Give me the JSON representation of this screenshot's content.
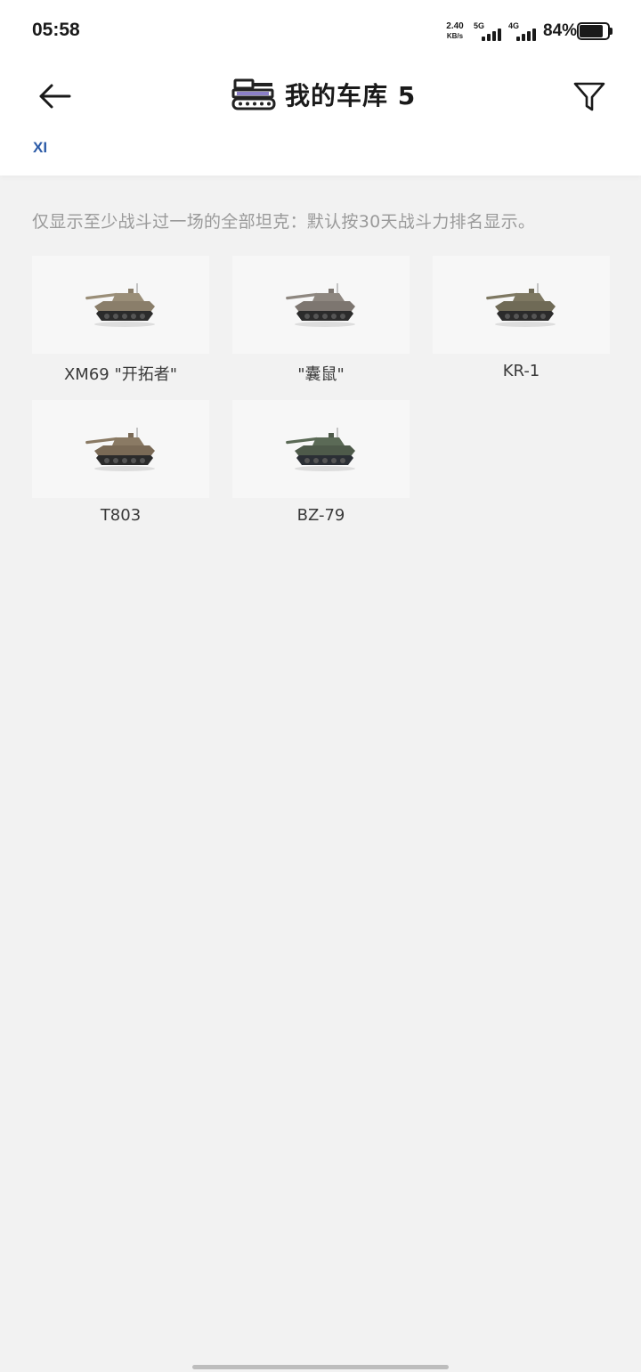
{
  "status_bar": {
    "time": "05:58",
    "net_speed_value": "2.40",
    "net_speed_unit": "KB/s",
    "signal_1_label": "5G",
    "signal_2_label": "4G",
    "battery_percent": "84%",
    "battery_level": 0.84
  },
  "header": {
    "title": "我的车库 5",
    "title_icon": "tank-garage-icon",
    "tier_tab": "XI"
  },
  "notice": "仅显示至少战斗过一场的全部坦克：默认按30天战斗力排名显示。",
  "tanks": [
    {
      "name": "XM69 \"开拓者\"",
      "icon": "tank-icon",
      "colors": {
        "body": "#8a7e6a",
        "turret": "#9a8e78",
        "track": "#2b2b2b"
      }
    },
    {
      "name": "\"囊鼠\"",
      "icon": "tank-icon",
      "colors": {
        "body": "#7d7670",
        "turret": "#8e8780",
        "track": "#2b2b2b"
      }
    },
    {
      "name": "KR-1",
      "icon": "tank-icon",
      "colors": {
        "body": "#6f6a56",
        "turret": "#7e7862",
        "track": "#2b2b2b"
      }
    },
    {
      "name": "T803",
      "icon": "tank-icon",
      "colors": {
        "body": "#7a6a56",
        "turret": "#8a7a64",
        "track": "#2b2b2b"
      }
    },
    {
      "name": "BZ-79",
      "icon": "tank-icon",
      "colors": {
        "body": "#4e5a4a",
        "turret": "#5b6a56",
        "track": "#2b2f35"
      }
    }
  ]
}
